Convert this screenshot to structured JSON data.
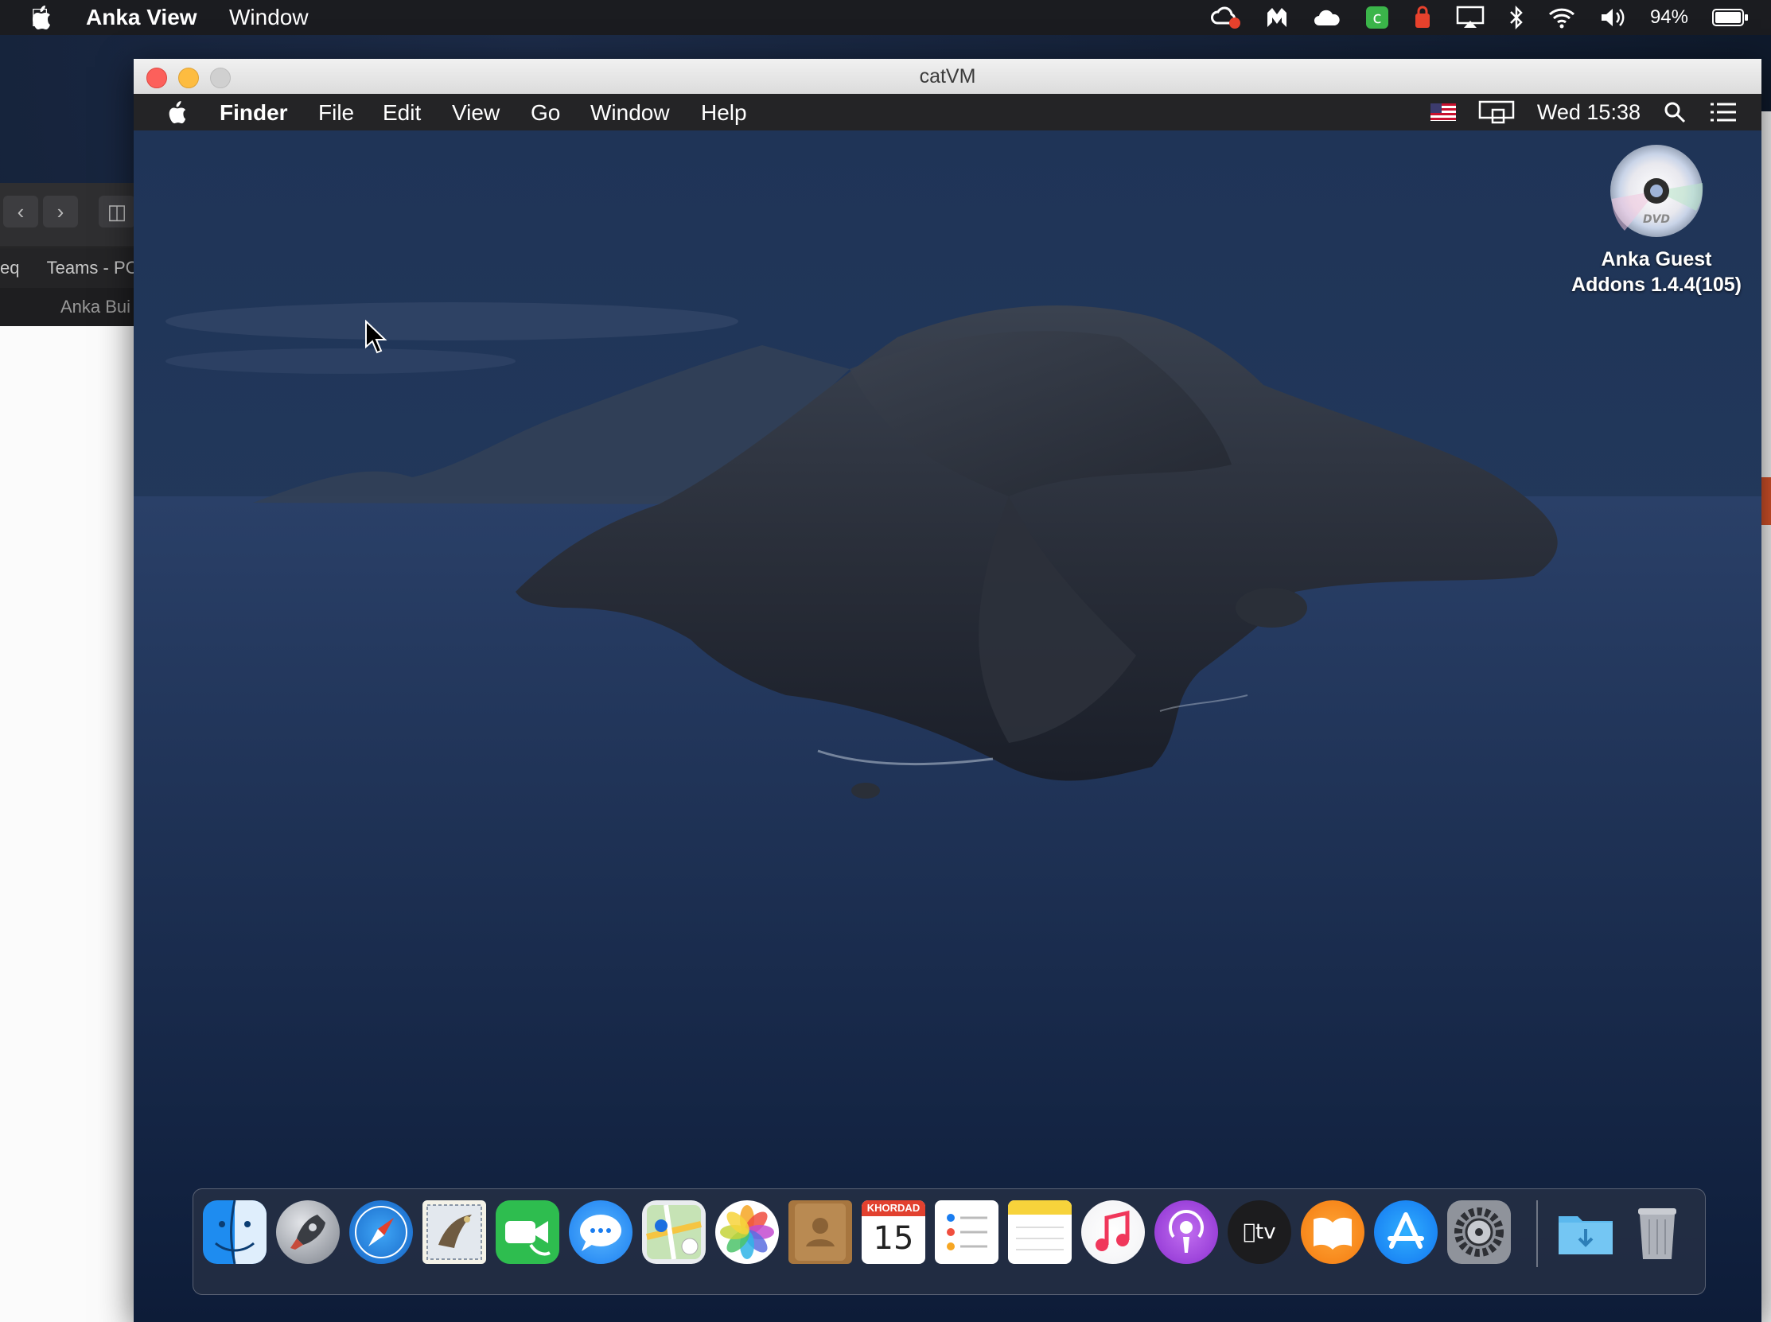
{
  "host": {
    "app_name": "Anka View",
    "menu_window": "Window",
    "battery": "94%",
    "status_icons": [
      "creative-cloud-icon",
      "malwarebytes-icon",
      "icloud-icon",
      "green-app-icon",
      "notification-red-icon",
      "airplay-icon",
      "bluetooth-icon",
      "wifi-icon",
      "volume-icon",
      "battery-icon"
    ]
  },
  "left_app": {
    "tab1": "eq",
    "tab2": "Teams - PC",
    "tab3": "Anka Bui"
  },
  "vm_window": {
    "title": "catVM"
  },
  "guest": {
    "menu": {
      "finder": "Finder",
      "file": "File",
      "edit": "Edit",
      "view": "View",
      "go": "Go",
      "window": "Window",
      "help": "Help"
    },
    "clock": "Wed 15:38",
    "desktop_icon": {
      "label_line1": "Anka Guest",
      "label_line2": "Addons 1.4.4(105)",
      "disc_text": "DVD"
    },
    "calendar_day": "15",
    "calendar_month": "KHORDAD",
    "dock_apps": [
      "Finder",
      "Launchpad",
      "Safari",
      "Mail",
      "FaceTime",
      "Messages",
      "Maps",
      "Photos",
      "Contacts",
      "Calendar",
      "Reminders",
      "Notes",
      "Music",
      "Podcasts",
      "TV",
      "Books",
      "App Store",
      "System Preferences",
      "Downloads",
      "Trash"
    ]
  },
  "colors": {
    "close": "#fc605b",
    "minimize": "#fdbc40",
    "zoom_disabled": "#d0d0d0",
    "host_menubar": "#1b1c20",
    "guest_menubar": "#242426"
  }
}
